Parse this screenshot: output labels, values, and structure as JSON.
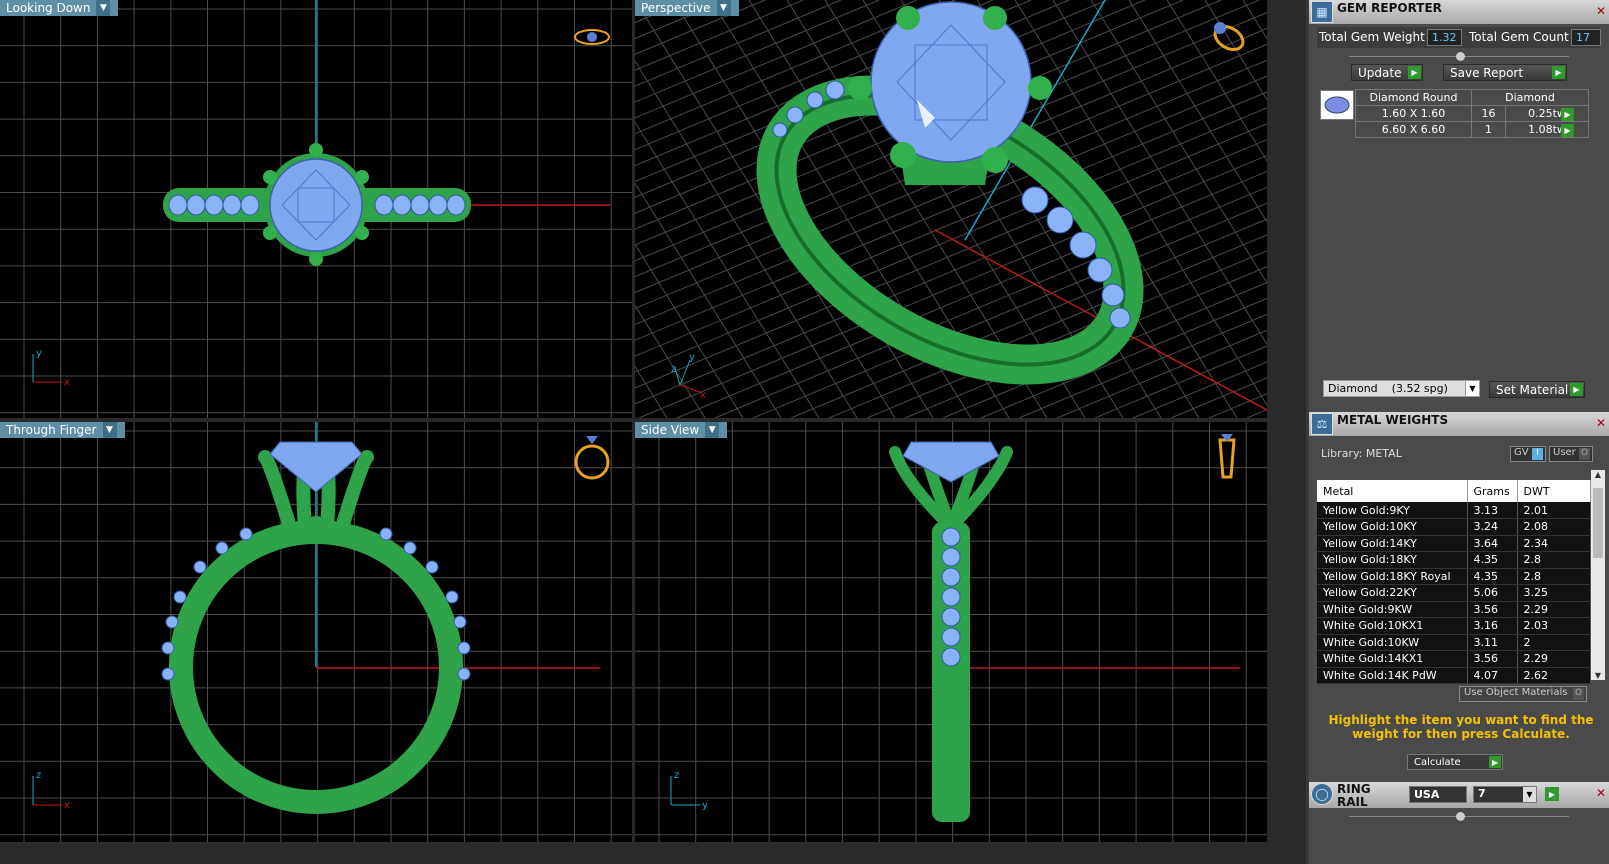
{
  "viewports": {
    "top_left": {
      "label": "Looking Down"
    },
    "top_right": {
      "label": "Perspective"
    },
    "bottom_left": {
      "label": "Through Finger"
    },
    "bottom_right": {
      "label": "Side View"
    }
  },
  "axes": {
    "x": "x",
    "y": "y",
    "z": "z"
  },
  "gem_reporter": {
    "title": "GEM REPORTER",
    "total_weight_label": "Total Gem Weight",
    "total_weight": "1.32",
    "total_count_label": "Total Gem Count",
    "total_count": "17",
    "update_label": "Update",
    "save_report_label": "Save Report",
    "table_header_shape": "Diamond Round",
    "table_header_material": "Diamond",
    "rows": [
      {
        "size": "1.60 X 1.60",
        "count": "16",
        "weight": "0.25tw"
      },
      {
        "size": "6.60 X 6.60",
        "count": "1",
        "weight": "1.08tw"
      }
    ],
    "material_select": "Diamond    (3.52 spg)",
    "set_material_label": "Set Material"
  },
  "metal_weights": {
    "title": "METAL WEIGHTS",
    "library_label": "Library: METAL",
    "gv_label": "GV",
    "user_label": "User",
    "columns": [
      "Metal",
      "Grams",
      "DWT"
    ],
    "rows": [
      {
        "metal": "Yellow Gold:9KY",
        "grams": "3.13",
        "dwt": "2.01"
      },
      {
        "metal": "Yellow Gold:10KY",
        "grams": "3.24",
        "dwt": "2.08"
      },
      {
        "metal": "Yellow Gold:14KY",
        "grams": "3.64",
        "dwt": "2.34"
      },
      {
        "metal": "Yellow Gold:18KY",
        "grams": "4.35",
        "dwt": "2.8"
      },
      {
        "metal": "Yellow Gold:18KY Royal",
        "grams": "4.35",
        "dwt": "2.8"
      },
      {
        "metal": "Yellow Gold:22KY",
        "grams": "5.06",
        "dwt": "3.25"
      },
      {
        "metal": "White Gold:9KW",
        "grams": "3.56",
        "dwt": "2.29"
      },
      {
        "metal": "White Gold:10KX1",
        "grams": "3.16",
        "dwt": "2.03"
      },
      {
        "metal": "White Gold:10KW",
        "grams": "3.11",
        "dwt": "2"
      },
      {
        "metal": "White Gold:14KX1",
        "grams": "3.56",
        "dwt": "2.29"
      },
      {
        "metal": "White Gold:14K PdW",
        "grams": "4.07",
        "dwt": "2.62"
      }
    ],
    "use_object_materials_label": "Use Object Materials",
    "hint": "Highlight the item you want to find the weight for then press Calculate.",
    "calculate_label": "Calculate"
  },
  "ring_rail": {
    "title": "RING RAIL",
    "country": "USA",
    "size": "7"
  },
  "colors": {
    "metal_green": "#2fa34a",
    "gem_blue": "#7fa8f0",
    "grid": "#555555",
    "axis_red": "#c0191c",
    "axis_blue": "#1aa7c7",
    "hint_yellow": "#f2c200"
  }
}
